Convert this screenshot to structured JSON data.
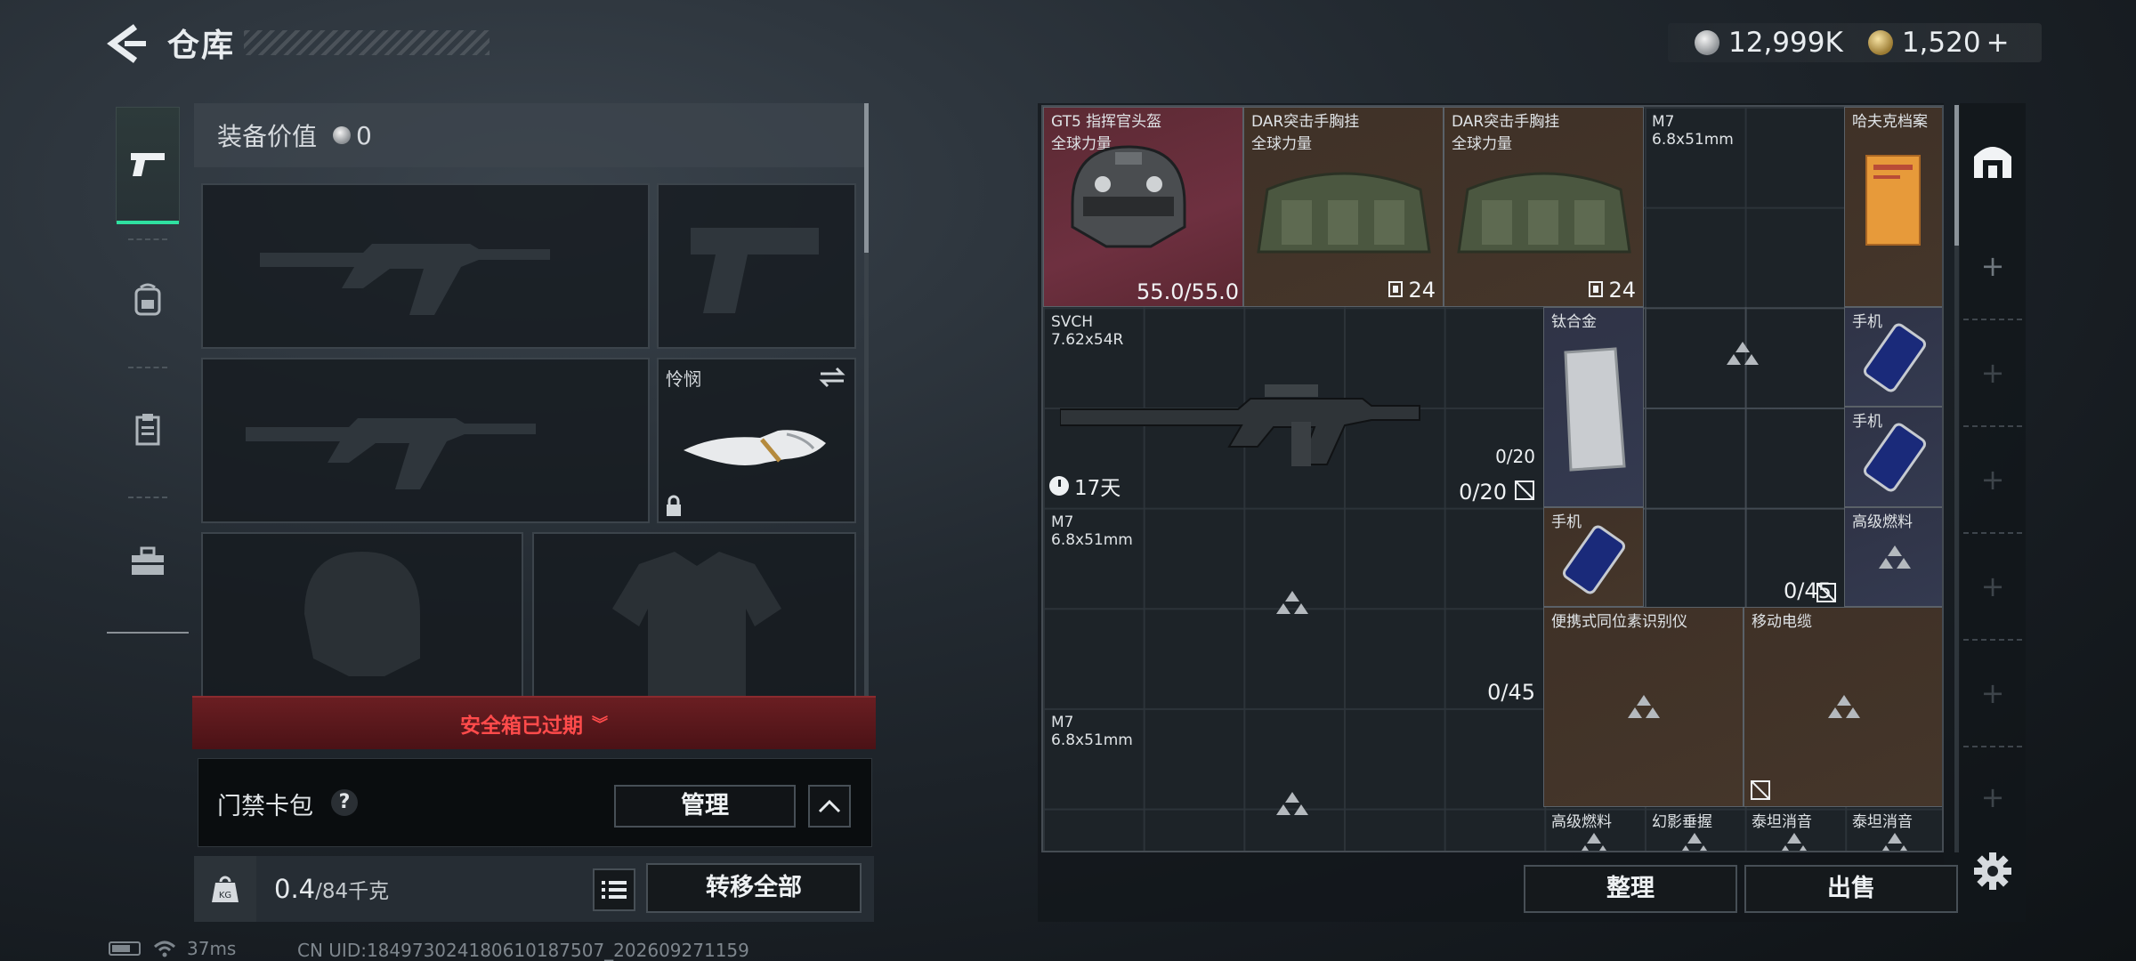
{
  "header": {
    "title": "仓库",
    "currency": {
      "silver": "12,999K",
      "gold": "1,520",
      "gold_plus": "+"
    }
  },
  "nav": {
    "items": [
      {
        "name": "weapons",
        "icon": "pistol-icon",
        "active": true
      },
      {
        "name": "backpack",
        "icon": "backpack-icon",
        "active": false
      },
      {
        "name": "clipboard",
        "icon": "clipboard-icon",
        "active": false
      },
      {
        "name": "toolbox",
        "icon": "toolbox-icon",
        "active": false
      }
    ]
  },
  "equipment": {
    "value_label": "装备价值",
    "value": "0",
    "melee_label": "怜悯",
    "warning": "安全箱已过期"
  },
  "keycard": {
    "label": "门禁卡包",
    "help": "?",
    "manage": "管理"
  },
  "weight": {
    "kg_label": "KG",
    "current": "0.4",
    "capacity": "/84千克",
    "transfer_all": "转移全部"
  },
  "status_bar": {
    "ping": "37ms",
    "uid": "CN UID:184973024180610187507_202609271159"
  },
  "storage": {
    "items": [
      {
        "name": "GT5 指挥官头盔",
        "sub": "全球力量",
        "durability": "55.0/55.0",
        "rarity": "red"
      },
      {
        "name": "DAR突击手胸挂",
        "sub": "全球力量",
        "count": "24",
        "rarity": "brown"
      },
      {
        "name": "DAR突击手胸挂",
        "sub": "全球力量",
        "count": "24",
        "rarity": "brown"
      },
      {
        "name": "M7",
        "sub": "6.8x51mm",
        "rarity": "plain"
      },
      {
        "name": "哈夫克档案",
        "rarity": "brown"
      },
      {
        "name": "SVCH",
        "sub": "7.62x54R",
        "timer": "17天",
        "ammo_small": "0/20",
        "ammo": "0/20",
        "rarity": "plain"
      },
      {
        "name": "钛合金",
        "rarity": "blue"
      },
      {
        "name": "手机",
        "rarity": "blue"
      },
      {
        "name": "手机",
        "rarity": "blue"
      },
      {
        "name": "M7",
        "sub": "6.8x51mm",
        "ammo_mid": "0/45",
        "ammo": "0/45",
        "rarity": "plain"
      },
      {
        "name": "手机",
        "rarity": "brown"
      },
      {
        "name": "高级燃料",
        "rarity": "blue"
      },
      {
        "name": "便携式同位素识别仪",
        "rarity": "brown"
      },
      {
        "name": "移动电缆",
        "rarity": "brown"
      },
      {
        "name": "M7",
        "sub": "6.8x51mm",
        "rarity": "plain"
      },
      {
        "name": "高级燃料",
        "rarity": "brown"
      },
      {
        "name": "幻影垂握",
        "rarity": "plain"
      },
      {
        "name": "泰坦消音",
        "rarity": "plain"
      },
      {
        "name": "泰坦消音",
        "rarity": "plain"
      }
    ],
    "sort": "整理",
    "sell": "出售"
  },
  "side": {
    "add": "+"
  },
  "colors": {
    "accent": "#2fe0a0",
    "warning": "#ff4b4b",
    "rarity_red": "#6e3040",
    "rarity_brown": "#45362a",
    "rarity_blue": "#343a50"
  }
}
